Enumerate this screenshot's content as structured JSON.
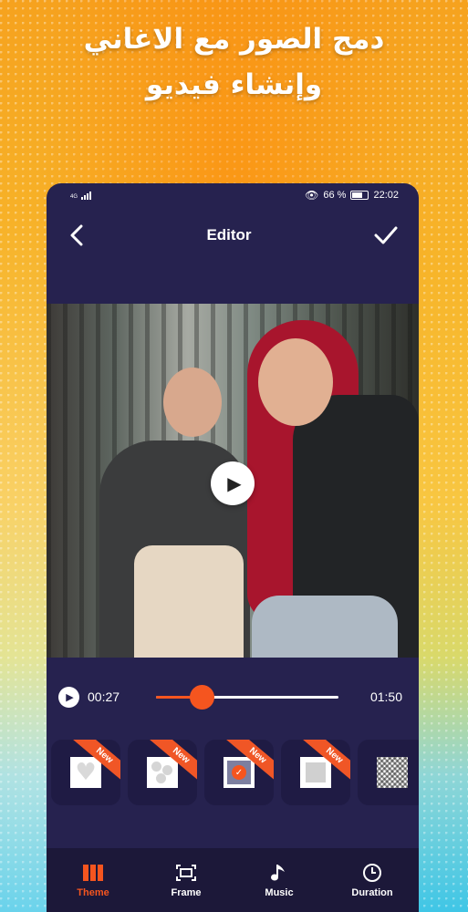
{
  "promo": {
    "line1": "دمج الصور مع الاغاني",
    "line2": "وإنشاء فيديو"
  },
  "status_bar": {
    "network": "4G",
    "battery_percent": "66 %",
    "time": "22:02"
  },
  "app_bar": {
    "back_icon": "chevron-left-icon",
    "title": "Editor",
    "confirm_icon": "checkmark-icon"
  },
  "player": {
    "current_time": "00:27",
    "total_time": "01:50",
    "progress": 0.25
  },
  "themes": [
    {
      "name": "heart",
      "badge": "New"
    },
    {
      "name": "bubbles",
      "badge": "New"
    },
    {
      "name": "selected",
      "badge": "New",
      "selected": true
    },
    {
      "name": "square",
      "badge": "New"
    },
    {
      "name": "mosaic",
      "badge": ""
    }
  ],
  "bottom_nav": [
    {
      "label": "Theme",
      "icon": "theme-icon",
      "active": true
    },
    {
      "label": "Frame",
      "icon": "frame-icon",
      "active": false
    },
    {
      "label": "Music",
      "icon": "music-note-icon",
      "active": false
    },
    {
      "label": "Duration",
      "icon": "clock-icon",
      "active": false
    }
  ],
  "colors": {
    "phone_bg": "#26224f",
    "accent": "#f5551f",
    "nav_bg": "#1c1839"
  }
}
